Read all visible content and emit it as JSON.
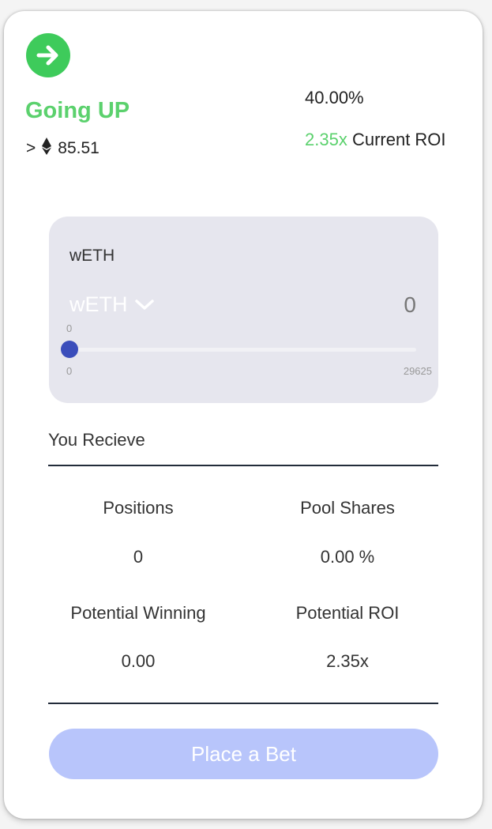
{
  "prediction": {
    "direction_label": "Going UP",
    "price_prefix": ">",
    "price_value": "85.51",
    "percentage": "40.00%",
    "roi_value": "2.35x",
    "roi_label": "Current ROI"
  },
  "bet_panel": {
    "token_label": "wETH",
    "selected_token": "wETH",
    "amount": "0",
    "slider": {
      "current_label": "0",
      "min_label": "0",
      "max_label": "29625",
      "level": 0
    }
  },
  "receive": {
    "heading": "You Recieve",
    "stats": [
      {
        "label": "Positions",
        "value": "0"
      },
      {
        "label": "Pool Shares",
        "value": "0.00 %"
      },
      {
        "label": "Potential Winning",
        "value": "0.00"
      },
      {
        "label": "Potential ROI",
        "value": "2.35x"
      }
    ]
  },
  "actions": {
    "place_bet_label": "Place a Bet"
  },
  "colors": {
    "up_green": "#5bd16d",
    "panel_bg": "#e6e6ee",
    "slider_thumb": "#3a4dbb",
    "button_bg": "#b8c5fb"
  },
  "icons": [
    "arrow-right-icon",
    "ethereum-icon",
    "chevron-down-icon"
  ]
}
